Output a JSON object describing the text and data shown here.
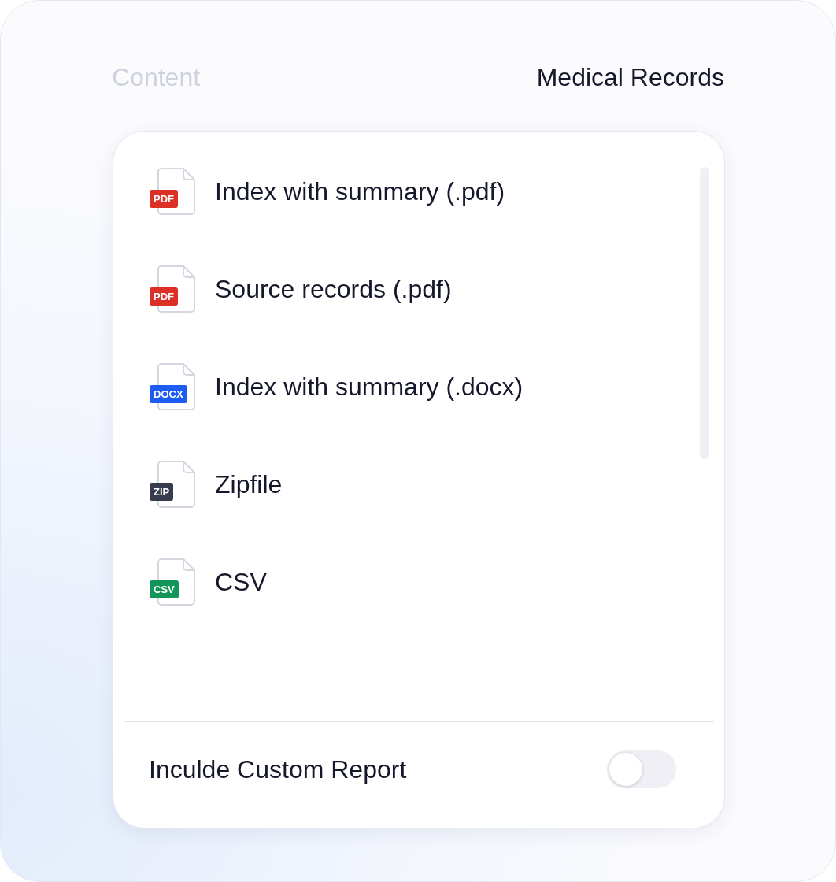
{
  "header": {
    "label": "Content",
    "title": "Medical Records"
  },
  "files": [
    {
      "badge": "PDF",
      "color": "#dc2f26",
      "name": "Index with summary (.pdf)"
    },
    {
      "badge": "PDF",
      "color": "#dc2f26",
      "name": "Source records (.pdf)"
    },
    {
      "badge": "DOCX",
      "color": "#1d5cf0",
      "name": "Index with summary (.docx)"
    },
    {
      "badge": "ZIP",
      "color": "#363c4e",
      "name": "Zipfile"
    },
    {
      "badge": "CSV",
      "color": "#11955a",
      "name": "CSV"
    }
  ],
  "custom_report": {
    "label": "Inculde Custom Report",
    "on": false
  }
}
